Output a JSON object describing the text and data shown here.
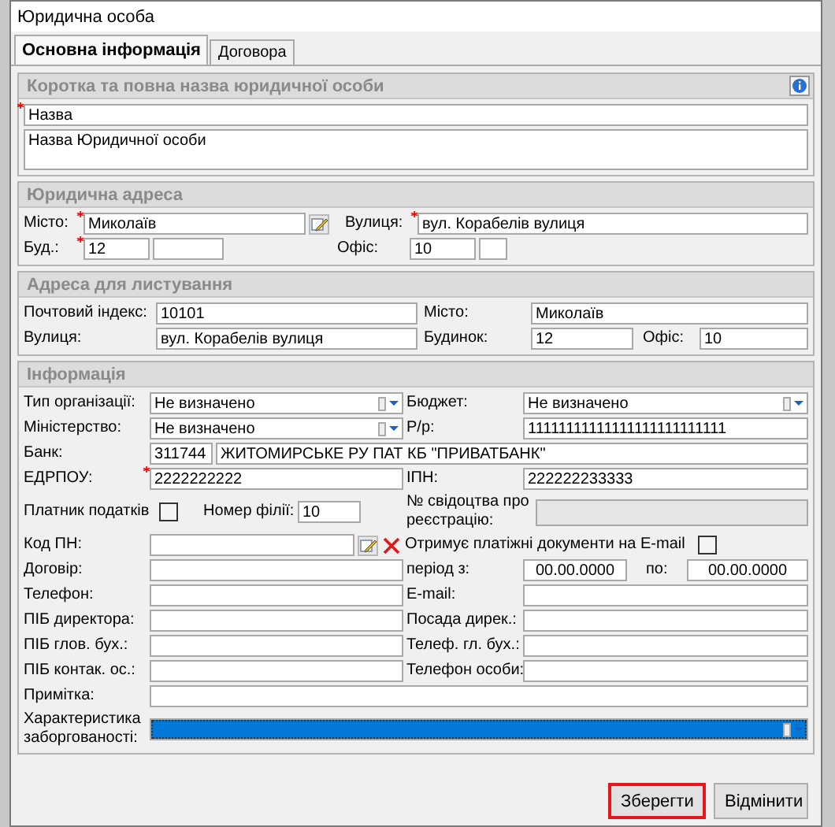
{
  "window": {
    "title": "Юридична особа"
  },
  "tabs": [
    {
      "label": "Основна інформація",
      "selected": true
    },
    {
      "label": "Договора",
      "selected": false
    }
  ],
  "sections": [
    {
      "title": "Коротка та повна назва юридичної особи",
      "info_button": true,
      "rows": [
        [
          {
            "kind": "input",
            "value": "Назва",
            "required": true
          }
        ],
        [
          {
            "kind": "textarea",
            "value": "Назва Юридичної особи"
          }
        ]
      ]
    },
    {
      "title": "Юридична адреса",
      "info_button": false,
      "rows": [
        [
          {
            "kind": "label",
            "text": "Місто:"
          },
          {
            "kind": "input",
            "value": "Миколаїв",
            "required": true
          },
          {
            "kind": "edit-button"
          },
          {
            "kind": "label",
            "text": "Вулиця:"
          },
          {
            "kind": "input",
            "value": "вул. Корабелів вулиця",
            "required": true
          }
        ],
        [
          {
            "kind": "label",
            "text": "Буд.:"
          },
          {
            "kind": "input",
            "value": "12",
            "required": true
          },
          {
            "kind": "input"
          },
          {
            "kind": "label",
            "text": "Офіс:"
          },
          {
            "kind": "input",
            "value": "10"
          },
          {
            "kind": "input"
          }
        ]
      ]
    },
    {
      "title": "Адреса для листування",
      "info_button": false,
      "rows": [
        [
          {
            "kind": "label",
            "text": "Почтовий індекс:"
          },
          {
            "kind": "input",
            "value": "10101"
          },
          {
            "kind": "label",
            "text": "Місто:"
          },
          {
            "kind": "input",
            "value": "Миколаїв"
          }
        ],
        [
          {
            "kind": "label",
            "text": "Вулиця:"
          },
          {
            "kind": "input",
            "value": "вул. Корабелів вулиця"
          },
          {
            "kind": "label",
            "text": "Будинок:"
          },
          {
            "kind": "input",
            "value": "12"
          },
          {
            "kind": "label",
            "text": "Офіс:"
          },
          {
            "kind": "input",
            "value": "10"
          }
        ]
      ]
    },
    {
      "title": "Інформація",
      "info_button": false,
      "rows": [
        [
          {
            "kind": "label",
            "text": "Тип організації:"
          },
          {
            "kind": "select",
            "value": "Не визначено",
            "highlighted": false
          },
          {
            "kind": "label",
            "text": "Бюджет:"
          },
          {
            "kind": "select",
            "value": "Не визначено",
            "highlighted": false
          }
        ],
        [
          {
            "kind": "label",
            "text": "Міністерство:"
          },
          {
            "kind": "select",
            "value": "Не визначено",
            "highlighted": false
          },
          {
            "kind": "label",
            "text": "Р/р:"
          },
          {
            "kind": "input",
            "value": "11111111111111111111111111"
          }
        ],
        [
          {
            "kind": "label",
            "text": "Банк:"
          },
          {
            "kind": "input",
            "value": "311744"
          },
          {
            "kind": "input",
            "value": "ЖИТОМИРСЬКЕ РУ ПАТ КБ \"ПРИВАТБАНК\""
          }
        ],
        [
          {
            "kind": "label",
            "text": "ЕДРПОУ:"
          },
          {
            "kind": "input",
            "value": "2222222222",
            "required": true
          },
          {
            "kind": "label",
            "text": "ІПН:"
          },
          {
            "kind": "input",
            "value": "222222233333"
          }
        ],
        [
          {
            "kind": "label",
            "text": "Платник податків"
          },
          {
            "kind": "checkbox",
            "checked": false
          },
          {
            "kind": "label",
            "text": "Номер філії:"
          },
          {
            "kind": "input",
            "value": "10"
          },
          {
            "kind": "label",
            "text": "№ свідоцтва про реєстрацію:"
          },
          {
            "kind": "input",
            "disabled": true
          }
        ],
        [
          {
            "kind": "label",
            "text": "Код ПН:"
          },
          {
            "kind": "input"
          },
          {
            "kind": "edit-button"
          },
          {
            "kind": "clear-button"
          },
          {
            "kind": "label",
            "text": "Отримує платіжні документи на E-mail"
          },
          {
            "kind": "checkbox",
            "checked": false
          }
        ],
        [
          {
            "kind": "label",
            "text": "Договір:"
          },
          {
            "kind": "input"
          },
          {
            "kind": "label",
            "text": "період з:"
          },
          {
            "kind": "date",
            "value": "00.00.0000"
          },
          {
            "kind": "label",
            "text": "по:"
          },
          {
            "kind": "date",
            "value": "00.00.0000"
          }
        ],
        [
          {
            "kind": "label",
            "text": "Телефон:"
          },
          {
            "kind": "input"
          },
          {
            "kind": "label",
            "text": "E-mail:"
          },
          {
            "kind": "input"
          }
        ],
        [
          {
            "kind": "label",
            "text": "ПІБ директора:"
          },
          {
            "kind": "input"
          },
          {
            "kind": "label",
            "text": "Посада дирек.:"
          },
          {
            "kind": "input"
          }
        ],
        [
          {
            "kind": "label",
            "text": "ПІБ глов. бух.:"
          },
          {
            "kind": "input"
          },
          {
            "kind": "label",
            "text": "Телеф. гл. бух.:"
          },
          {
            "kind": "input"
          }
        ],
        [
          {
            "kind": "label",
            "text": "ПІБ контак. ос.:"
          },
          {
            "kind": "input"
          },
          {
            "kind": "label",
            "text": "Телефон особи:"
          },
          {
            "kind": "input"
          }
        ],
        [
          {
            "kind": "label",
            "text": "Примітка:"
          },
          {
            "kind": "input"
          }
        ],
        [
          {
            "kind": "label",
            "text": "Характеристика заборгованості:"
          },
          {
            "kind": "select",
            "highlighted": true
          }
        ]
      ]
    }
  ],
  "buttons": [
    {
      "label": "Зберегти",
      "focused": true
    },
    {
      "label": "Відмінити",
      "focused": false
    }
  ]
}
